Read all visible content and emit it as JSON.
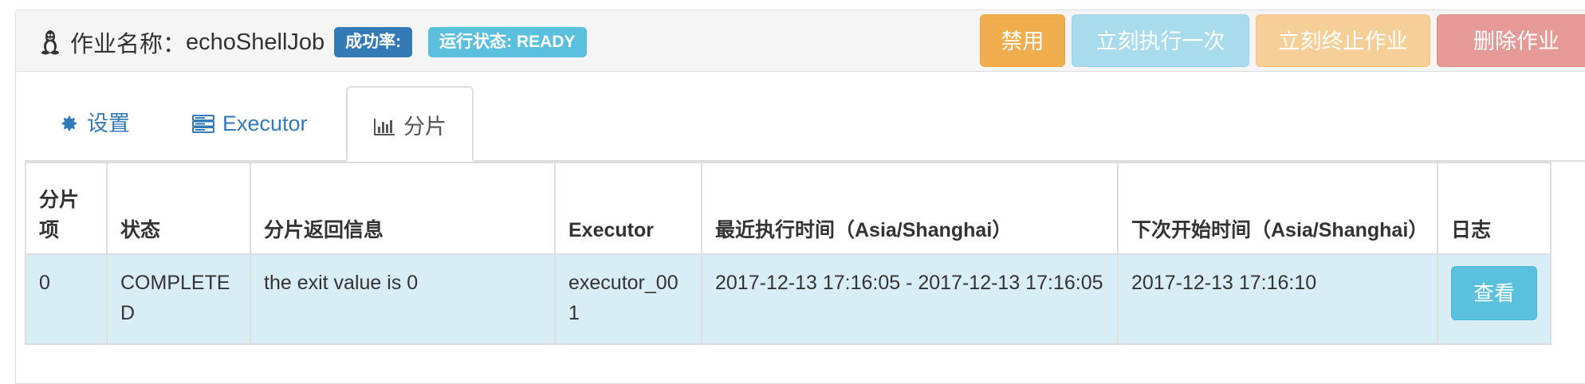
{
  "header": {
    "job_label": "作业名称：",
    "job_name": "echoShellJob",
    "success_badge": "成功率:",
    "status_badge": "运行状态: READY"
  },
  "actions": {
    "disable": "禁用",
    "trigger_once": "立刻执行一次",
    "shutdown": "立刻终止作业",
    "delete": "删除作业"
  },
  "tabs": [
    {
      "label": "设置",
      "icon": "gear-icon"
    },
    {
      "label": "Executor",
      "icon": "server-icon"
    },
    {
      "label": "分片",
      "icon": "bar-chart-icon"
    }
  ],
  "active_tab": "分片",
  "table": {
    "columns": [
      "分片项",
      "状态",
      "分片返回信息",
      "Executor",
      "最近执行时间（Asia/Shanghai）",
      "下次开始时间（Asia/Shanghai）",
      "日志"
    ],
    "rows": [
      {
        "item": "0",
        "status": "COMPLETED",
        "message": "the exit value is 0",
        "executor": "executor_001",
        "last_run": "2017-12-13 17:16:05 - 2017-12-13 17:16:05",
        "next_run": "2017-12-13 17:16:10",
        "log_button": "查看"
      }
    ]
  },
  "colors": {
    "primary": "#337ab7",
    "info": "#5bc0de",
    "warning": "#f0ad4e",
    "danger": "#d9534f",
    "row_highlight": "#d9edf7"
  }
}
